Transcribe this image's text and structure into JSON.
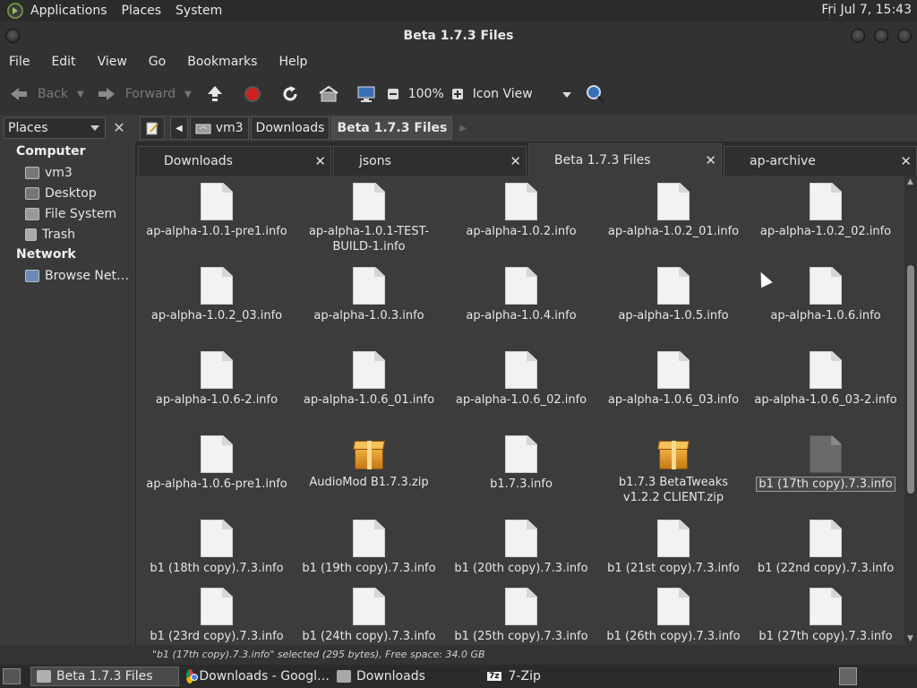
{
  "top_panel": {
    "menus": [
      "Applications",
      "Places",
      "System"
    ],
    "clock": "Fri Jul  7, 15:43"
  },
  "window": {
    "title": "Beta 1.7.3 Files"
  },
  "menubar": [
    "File",
    "Edit",
    "View",
    "Go",
    "Bookmarks",
    "Help"
  ],
  "toolbar": {
    "back_label": "Back",
    "forward_label": "Forward",
    "zoom": "100%",
    "view_mode": "Icon View"
  },
  "sidebar": {
    "selector_label": "Places",
    "sections": [
      {
        "heading": "Computer",
        "items": [
          {
            "label": "vm3",
            "icon": "home-folder-icon"
          },
          {
            "label": "Desktop",
            "icon": "desktop-folder-icon"
          },
          {
            "label": "File System",
            "icon": "drive-icon"
          },
          {
            "label": "Trash",
            "icon": "trash-icon"
          }
        ]
      },
      {
        "heading": "Network",
        "items": [
          {
            "label": "Browse Net…",
            "icon": "network-icon"
          }
        ]
      }
    ]
  },
  "breadcrumbs": [
    "vm3",
    "Downloads",
    "Beta 1.7.3 Files"
  ],
  "tabs": [
    "Downloads",
    "jsons",
    "Beta 1.7.3 Files",
    "ap-archive"
  ],
  "active_tab": "Beta 1.7.3 Files",
  "files": [
    {
      "name": "ap-alpha-1.0.1-pre1.info",
      "type": "document"
    },
    {
      "name": "ap-alpha-1.0.1-TEST-BUILD-1.info",
      "type": "document"
    },
    {
      "name": "ap-alpha-1.0.2.info",
      "type": "document"
    },
    {
      "name": "ap-alpha-1.0.2_01.info",
      "type": "document"
    },
    {
      "name": "ap-alpha-1.0.2_02.info",
      "type": "document"
    },
    {
      "name": "ap-alpha-1.0.2_03.info",
      "type": "document"
    },
    {
      "name": "ap-alpha-1.0.3.info",
      "type": "document"
    },
    {
      "name": "ap-alpha-1.0.4.info",
      "type": "document"
    },
    {
      "name": "ap-alpha-1.0.5.info",
      "type": "document"
    },
    {
      "name": "ap-alpha-1.0.6.info",
      "type": "document"
    },
    {
      "name": "ap-alpha-1.0.6-2.info",
      "type": "document"
    },
    {
      "name": "ap-alpha-1.0.6_01.info",
      "type": "document"
    },
    {
      "name": "ap-alpha-1.0.6_02.info",
      "type": "document"
    },
    {
      "name": "ap-alpha-1.0.6_03.info",
      "type": "document"
    },
    {
      "name": "ap-alpha-1.0.6_03-2.info",
      "type": "document"
    },
    {
      "name": "ap-alpha-1.0.6-pre1.info",
      "type": "document"
    },
    {
      "name": "AudioMod B1.7.3.zip",
      "type": "archive"
    },
    {
      "name": "b1.7.3.info",
      "type": "document"
    },
    {
      "name": "b1.7.3 BetaTweaks v1.2.2 CLIENT.zip",
      "type": "archive"
    },
    {
      "name": "b1 (17th copy).7.3.info",
      "type": "document",
      "selected": true
    },
    {
      "name": "b1 (18th copy).7.3.info",
      "type": "document"
    },
    {
      "name": "b1 (19th copy).7.3.info",
      "type": "document"
    },
    {
      "name": "b1 (20th copy).7.3.info",
      "type": "document"
    },
    {
      "name": "b1 (21st copy).7.3.info",
      "type": "document"
    },
    {
      "name": "b1 (22nd copy).7.3.info",
      "type": "document"
    },
    {
      "name": "b1 (23rd copy).7.3.info",
      "type": "document"
    },
    {
      "name": "b1 (24th copy).7.3.info",
      "type": "document"
    },
    {
      "name": "b1 (25th copy).7.3.info",
      "type": "document"
    },
    {
      "name": "b1 (26th copy).7.3.info",
      "type": "document"
    },
    {
      "name": "b1 (27th copy).7.3.info",
      "type": "document"
    }
  ],
  "status": "\"b1 (17th copy).7.3.info\" selected (295 bytes), Free space: 34.0 GB",
  "taskbar": [
    {
      "label": "Beta 1.7.3 Files",
      "icon": "folder-icon",
      "active": true
    },
    {
      "label": "Downloads - Googl…",
      "icon": "chrome-icon",
      "active": false
    },
    {
      "label": "Downloads",
      "icon": "folder-icon",
      "active": false
    },
    {
      "label": "7-Zip",
      "icon": "7zip-icon",
      "active": false
    }
  ],
  "colors": {
    "background": "#3c3c3c",
    "panel": "#2b2b2b",
    "text": "#e6e6e6",
    "archive": "#e8a030"
  }
}
